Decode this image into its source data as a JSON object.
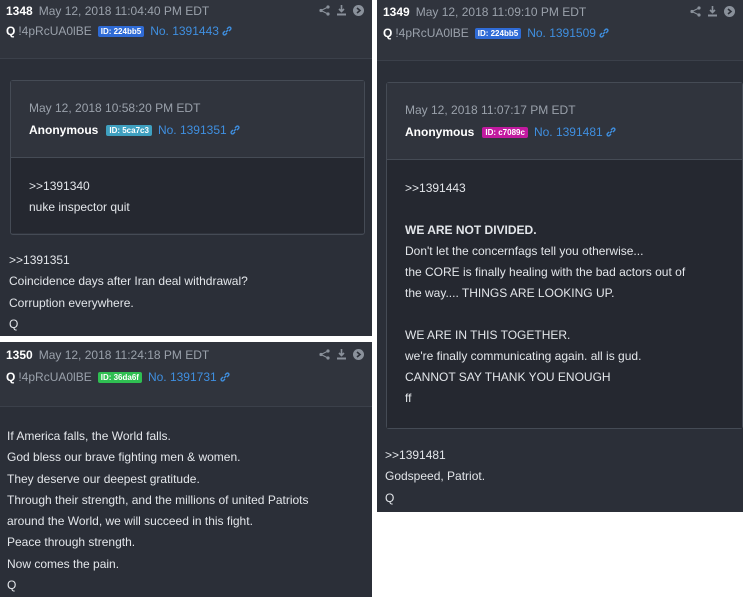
{
  "colors": {
    "panel": "#2b2f38",
    "link": "#3f8fe0",
    "id_blue": "#2f6bd6",
    "id_teal": "#3fa0c0",
    "id_pink": "#c21aa0",
    "id_green": "#2fbf52"
  },
  "post1348": {
    "number": "1348",
    "date": "May 12, 2018 11:04:40 PM EDT",
    "name": "Q",
    "trip": "!4pRcUA0lBE",
    "id": "ID: 224bb5",
    "post_link": "No. 1391443",
    "quoted": {
      "date": "May 12, 2018 10:58:20 PM EDT",
      "name": "Anonymous",
      "id": "ID: 5ca7c3",
      "post_link": "No. 1391351",
      "lines": [
        ">>1391340",
        "nuke inspector quit"
      ]
    },
    "lines": [
      ">>1391351",
      "Coincidence days after Iran deal withdrawal?",
      "Corruption everywhere.",
      "Q"
    ]
  },
  "post1350": {
    "number": "1350",
    "date": "May 12, 2018 11:24:18 PM EDT",
    "name": "Q",
    "trip": "!4pRcUA0lBE",
    "id": "ID: 36da6f",
    "post_link": "No. 1391731",
    "lines": [
      "If America falls, the World falls.",
      "God bless our brave fighting men & women.",
      "They deserve our deepest gratitude.",
      "Through their strength, and the millions of united Patriots",
      "around the World, we will succeed in this fight.",
      "Peace through strength.",
      "Now comes the pain.",
      "Q"
    ]
  },
  "post1349": {
    "number": "1349",
    "date": "May 12, 2018 11:09:10 PM EDT",
    "name": "Q",
    "trip": "!4pRcUA0lBE",
    "id": "ID: 224bb5",
    "post_link": "No. 1391509",
    "quoted": {
      "date": "May 12, 2018 11:07:17 PM EDT",
      "name": "Anonymous",
      "id": "ID: c7089c",
      "post_link": "No. 1391481",
      "line0": ">>1391443",
      "bold": "WE ARE NOT DIVIDED.",
      "lines_a": [
        "Don't let the concernfags tell you otherwise...",
        "the CORE is finally healing with the bad actors out of",
        "the way.... THINGS ARE LOOKING UP."
      ],
      "lines_b": [
        "WE ARE IN THIS TOGETHER.",
        "we're finally communicating again. all is gud.",
        "CANNOT SAY THANK YOU ENOUGH",
        "ff"
      ]
    },
    "lines": [
      ">>1391481",
      "Godspeed, Patriot.",
      "Q"
    ]
  },
  "icons": [
    "share-icon",
    "download-icon",
    "forward-icon"
  ]
}
